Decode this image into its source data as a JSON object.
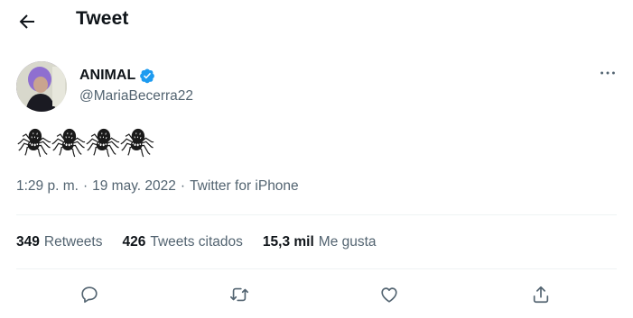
{
  "header": {
    "title": "Tweet",
    "back_icon": "arrow-left-icon"
  },
  "author": {
    "name": "ANIMAL",
    "handle": "@MariaBecerra22",
    "verified": true,
    "verified_color": "#1d9bf0"
  },
  "tweet": {
    "spiders": [
      "🕷",
      "🕷",
      "🕷",
      "🕷"
    ]
  },
  "meta": {
    "time": "1:29 p. m.",
    "sep1": "·",
    "date": "19 may. 2022",
    "sep2": "·",
    "source": "Twitter for iPhone"
  },
  "stats": [
    {
      "count": "349",
      "label": "Retweets"
    },
    {
      "count": "426",
      "label": "Tweets citados"
    },
    {
      "count": "15,3 mil",
      "label": "Me gusta"
    }
  ],
  "actions": [
    "reply-icon",
    "retweet-icon",
    "like-icon",
    "share-icon"
  ]
}
